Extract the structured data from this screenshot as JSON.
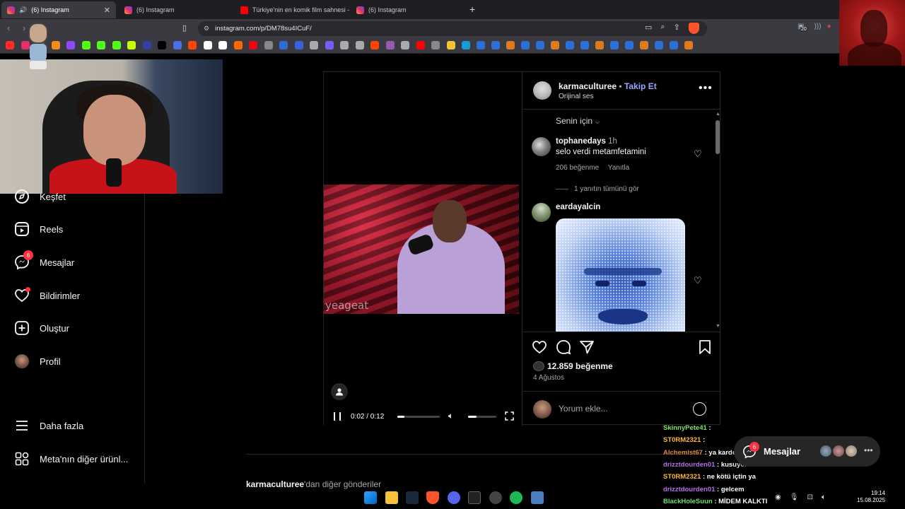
{
  "browser": {
    "tabs": [
      {
        "title": "(6) Instagram",
        "active": true,
        "type": "instagram"
      },
      {
        "title": "(6) Instagram",
        "active": false,
        "type": "instagram"
      },
      {
        "title": "Türkiye'nin en komik film sahnesi - Y",
        "active": false,
        "type": "youtube"
      },
      {
        "title": "(6) Instagram",
        "active": false,
        "type": "instagram"
      }
    ],
    "url": "instagram.com/p/DM78su4ICuF/",
    "extension_badge": "20"
  },
  "nav": {
    "items": [
      {
        "label": "Keşfet",
        "icon": "compass-icon"
      },
      {
        "label": "Reels",
        "icon": "reels-icon"
      },
      {
        "label": "Mesajlar",
        "icon": "messenger-icon",
        "badge": "6"
      },
      {
        "label": "Bildirimler",
        "icon": "heart-icon"
      },
      {
        "label": "Oluştur",
        "icon": "plus-square-icon"
      },
      {
        "label": "Profil",
        "icon": "avatar"
      },
      {
        "label": "Daha fazla",
        "icon": "menu-icon"
      },
      {
        "label": "Meta'nın diğer ürünl...",
        "icon": "apps-icon"
      }
    ]
  },
  "video": {
    "watermark": "yeageat",
    "time": "0:02 / 0:12",
    "progress": 0.17,
    "volume": 0.3
  },
  "post": {
    "author": "karmaculturee",
    "separator": "•",
    "follow_label": "Takip Et",
    "audio": "Orijinal ses",
    "sort_label": "Senin için",
    "likes": "12.859 beğenme",
    "date": "4 Ağustos",
    "comment_placeholder": "Yorum ekle..."
  },
  "comments": [
    {
      "user": "tophanedays",
      "age": "1h",
      "text": "selo verdi metamfetamini",
      "likes": "206 beğenme",
      "reply": "Yanıtla",
      "view_replies": "1 yanıtın tümünü gör"
    },
    {
      "user": "eardayalcin"
    }
  ],
  "more_posts": {
    "bold": "karmaculturee",
    "rest": "'dan diğer gönderiler"
  },
  "chat": [
    {
      "user": "SkinnyPete41",
      "color": "#7ee06a",
      "msg": ""
    },
    {
      "user": "ST0RM2321",
      "color": "#ffb833",
      "msg": ""
    },
    {
      "user": "Alchemist67",
      "color": "#e0883a",
      "msg": "ya kardeşim"
    },
    {
      "user": "drizztdourden01",
      "color": "#b46ee8",
      "msg": "kusuyorum abi"
    },
    {
      "user": "ST0RM2321",
      "color": "#ffb833",
      "msg": "ne kötü içtin ya"
    },
    {
      "user": "drizztdourden01",
      "color": "#b46ee8",
      "msg": "gelcem"
    },
    {
      "user": "BlackHoleSuun",
      "color": "#6be06a",
      "msg": "MİDEM KALKTI"
    }
  ],
  "messages_pill": {
    "label": "Mesajlar",
    "badge": "6"
  },
  "clock": {
    "time": "19:14",
    "date": "15.08.2025"
  },
  "colors": {
    "accent": "#9aa8ff",
    "badge": "#ff3040",
    "bg": "#000000"
  }
}
